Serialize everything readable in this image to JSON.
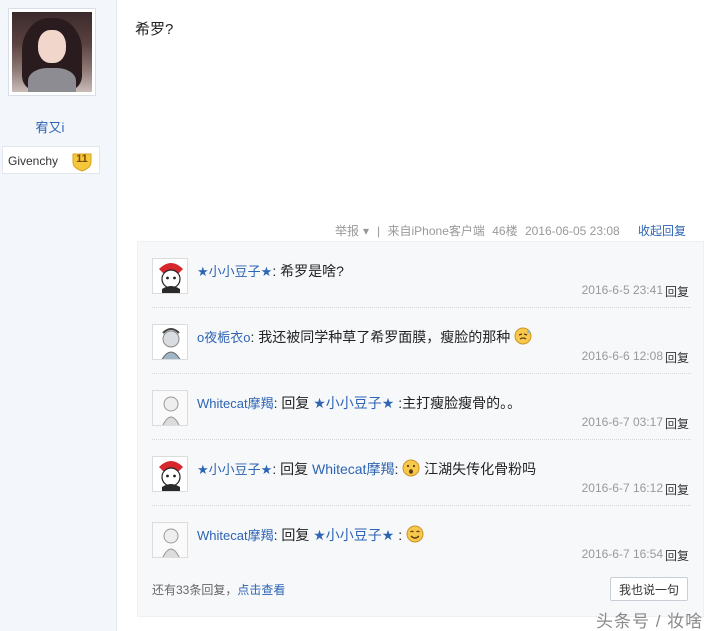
{
  "user": {
    "name": "宥又i",
    "badge_name": "Givenchy",
    "badge_level": "11"
  },
  "post": {
    "text": "希罗?",
    "report_label": "举报",
    "source": "来自iPhone客户端",
    "floor": "46楼",
    "datetime": "2016-06-05 23:08",
    "collapse_label": "收起回复"
  },
  "replies": [
    {
      "author": "★小小豆子★",
      "before": "",
      "reply_word": "",
      "mention": "",
      "content": "希罗是啥?",
      "emoji": "",
      "time": "2016-6-5 23:41",
      "reply_label": "回复"
    },
    {
      "author": "o夜栀衣o",
      "before": "",
      "reply_word": "",
      "mention": "",
      "content": "我还被同学种草了希罗面膜，瘦脸的那种",
      "emoji": "sweat-emoji",
      "time": "2016-6-6 12:08",
      "reply_label": "回复"
    },
    {
      "author": "Whitecat摩羯",
      "reply_word": "回复",
      "mention": "★小小豆子★",
      "content": ":主打瘦脸瘦骨的。。",
      "emoji": "",
      "time": "2016-6-7 03:17",
      "reply_label": "回复"
    },
    {
      "author": "★小小豆子★",
      "reply_word": "回复",
      "mention": "Whitecat摩羯",
      "content": "江湖失传化骨粉吗",
      "emoji": "surprised-emoji",
      "time": "2016-6-7 16:12",
      "reply_label": "回复"
    },
    {
      "author": "Whitecat摩羯",
      "reply_word": "回复",
      "mention": "★小小豆子★",
      "content": ":",
      "emoji": "smile-emoji",
      "time": "2016-6-7 16:54",
      "reply_label": "回复"
    }
  ],
  "footer": {
    "more_prefix": "还有33条回复，",
    "more_link": "点击查看",
    "say_button": "我也说一句"
  },
  "watermark": "头条号 / 妆啥",
  "colors": {
    "link": "#2d64b3",
    "sidebar_bg": "#f3f7fb",
    "reply_bg": "#f7f8fa"
  }
}
